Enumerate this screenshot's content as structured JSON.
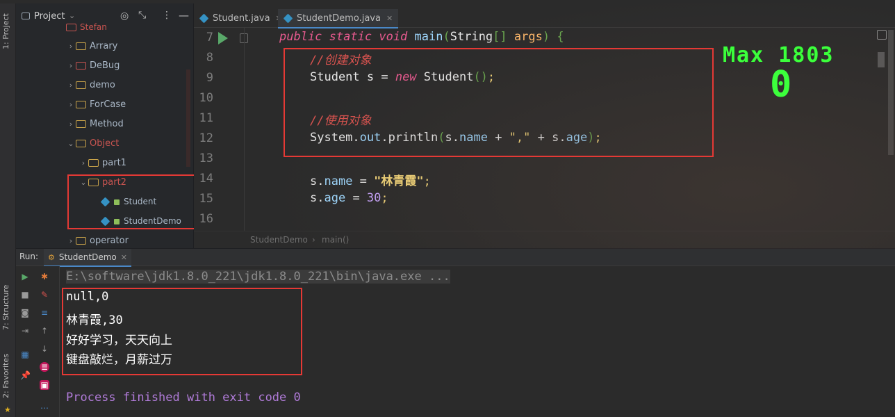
{
  "sidebar": {
    "tab_project": "1: Project",
    "tab_structure": "7: Structure",
    "tab_favorites": "2: Favorites"
  },
  "project": {
    "title": "Project",
    "partial_top": "Stefan",
    "items": [
      {
        "label": "Arrary",
        "type": "folder",
        "expanded": false
      },
      {
        "label": "DeBug",
        "type": "folder",
        "expanded": false
      },
      {
        "label": "demo",
        "type": "folder",
        "expanded": false
      },
      {
        "label": "ForCase",
        "type": "folder",
        "expanded": false
      },
      {
        "label": "Method",
        "type": "folder",
        "expanded": false
      },
      {
        "label": "Object",
        "type": "folder",
        "expanded": true
      },
      {
        "label": "part1",
        "type": "folder",
        "expanded": false
      },
      {
        "label": "part2",
        "type": "folder",
        "expanded": true
      },
      {
        "label": "Student",
        "type": "class"
      },
      {
        "label": "StudentDemo",
        "type": "class"
      },
      {
        "label": "operator",
        "type": "folder",
        "expanded": false
      }
    ]
  },
  "editor": {
    "tabs": [
      {
        "label": "Student.java",
        "active": false
      },
      {
        "label": "StudentDemo.java",
        "active": true
      }
    ],
    "line_numbers": [
      "7",
      "8",
      "9",
      "10",
      "11",
      "12",
      "13",
      "14",
      "15",
      "16"
    ],
    "code": {
      "l7_public": "public",
      "l7_static": "static",
      "l7_void": "void",
      "l7_main": "main",
      "l7_open": "(",
      "l7_String": "String",
      "l7_brackets": "[]",
      "l7_args": "args",
      "l7_close": ")",
      "l7_brace": "{",
      "l8_comment": "//创建对象",
      "l9_a": "Student s = ",
      "l9_new": "new",
      "l9_b": " Student",
      "l9_paren": "()",
      "l9_semi": ";",
      "l11_comment": "//使用对象",
      "l12_a": "System.",
      "l12_out": "out",
      "l12_b": ".println",
      "l12_paren_open": "(",
      "l12_c": "s.",
      "l12_name": "name",
      "l12_d": " + ",
      "l12_str": "\",\"",
      "l12_e": " + s.",
      "l12_age": "age",
      "l12_paren_close": ")",
      "l12_semi": ";",
      "l14_a": "s.",
      "l14_name": "name",
      "l14_b": " = ",
      "l14_str": "\"林青霞\"",
      "l14_semi": ";",
      "l15_a": "s.",
      "l15_age": "age",
      "l15_b": " = ",
      "l15_num": "30",
      "l15_semi": ";"
    },
    "breadcrumb": [
      "StudentDemo",
      "main()"
    ]
  },
  "overlay": {
    "max_label": "Max 1803",
    "value": "0"
  },
  "run": {
    "label": "Run:",
    "tab": "StudentDemo",
    "command": "E:\\software\\jdk1.8.0_221\\jdk1.8.0_221\\bin\\java.exe ...",
    "output": [
      "null,0",
      "林青霞,30",
      "好好学习，天天向上",
      "键盘敲烂，月薪过万"
    ],
    "finish": "Process finished with exit code 0"
  },
  "colors": {
    "highlight_box": "#e53935",
    "keyword": "#e75a8f",
    "string": "#f5d77a",
    "comment": "#d9534f",
    "overlay_green": "#3cff3c"
  }
}
